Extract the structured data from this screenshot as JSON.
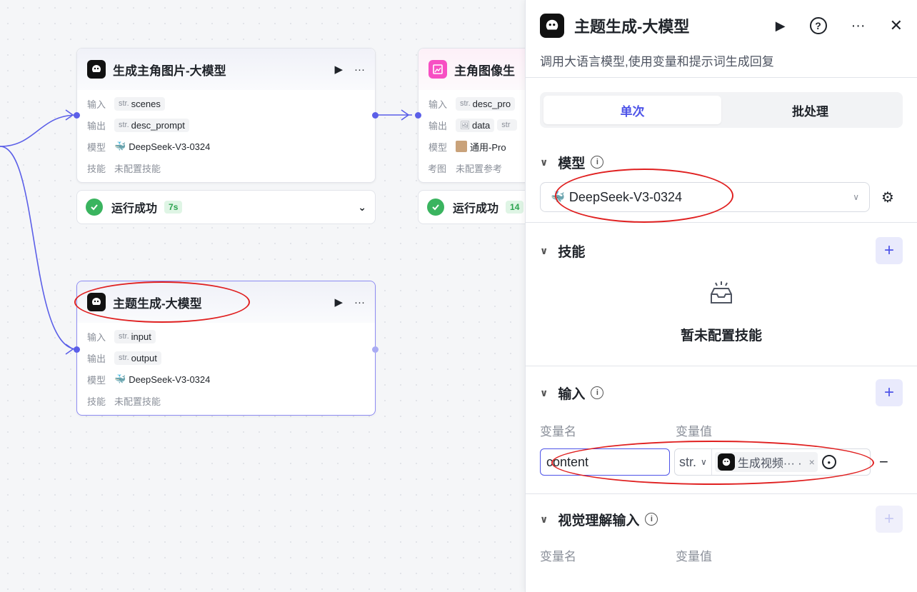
{
  "canvas": {
    "node1": {
      "title": "生成主角图片-大模型",
      "input_label": "输入",
      "input_type": "str.",
      "input_value": "scenes",
      "output_label": "输出",
      "output_type": "str.",
      "output_value": "desc_prompt",
      "model_label": "模型",
      "model_value": "DeepSeek-V3-0324",
      "skill_label": "技能",
      "skill_value": "未配置技能",
      "status_text": "运行成功",
      "status_time": "7s"
    },
    "node2": {
      "title": "主角图像生",
      "input_label": "输入",
      "input_type": "str.",
      "input_value": "desc_pro",
      "output_label": "输出",
      "output_value": "data",
      "output_type2": "str",
      "model_label": "模型",
      "model_value": "通用-Pro",
      "ref_label": "参考图",
      "ref_value": "未配置参考",
      "status_text": "运行成功",
      "status_time": "14"
    },
    "node3": {
      "title": "主题生成-大模型",
      "input_label": "输入",
      "input_type": "str.",
      "input_value": "input",
      "output_label": "输出",
      "output_type": "str.",
      "output_value": "output",
      "model_label": "模型",
      "model_value": "DeepSeek-V3-0324",
      "skill_label": "技能",
      "skill_value": "未配置技能"
    }
  },
  "panel": {
    "title": "主题生成-大模型",
    "description": "调用大语言模型,使用变量和提示词生成回复",
    "tabs": [
      "单次",
      "批处理"
    ],
    "model_section": {
      "title": "模型",
      "selected": "DeepSeek-V3-0324"
    },
    "skill_section": {
      "title": "技能",
      "empty_text": "暂未配置技能"
    },
    "input_section": {
      "title": "输入",
      "col_name": "变量名",
      "col_value": "变量值",
      "var_name": "content",
      "var_type": "str.",
      "ref_text": "生成视频··· ·"
    },
    "vision_section": {
      "title": "视觉理解输入",
      "col_name": "变量名",
      "col_value": "变量值"
    }
  },
  "colors": {
    "accent": "#4d53e8",
    "success": "#3ab45f",
    "annotation": "#e02020"
  }
}
